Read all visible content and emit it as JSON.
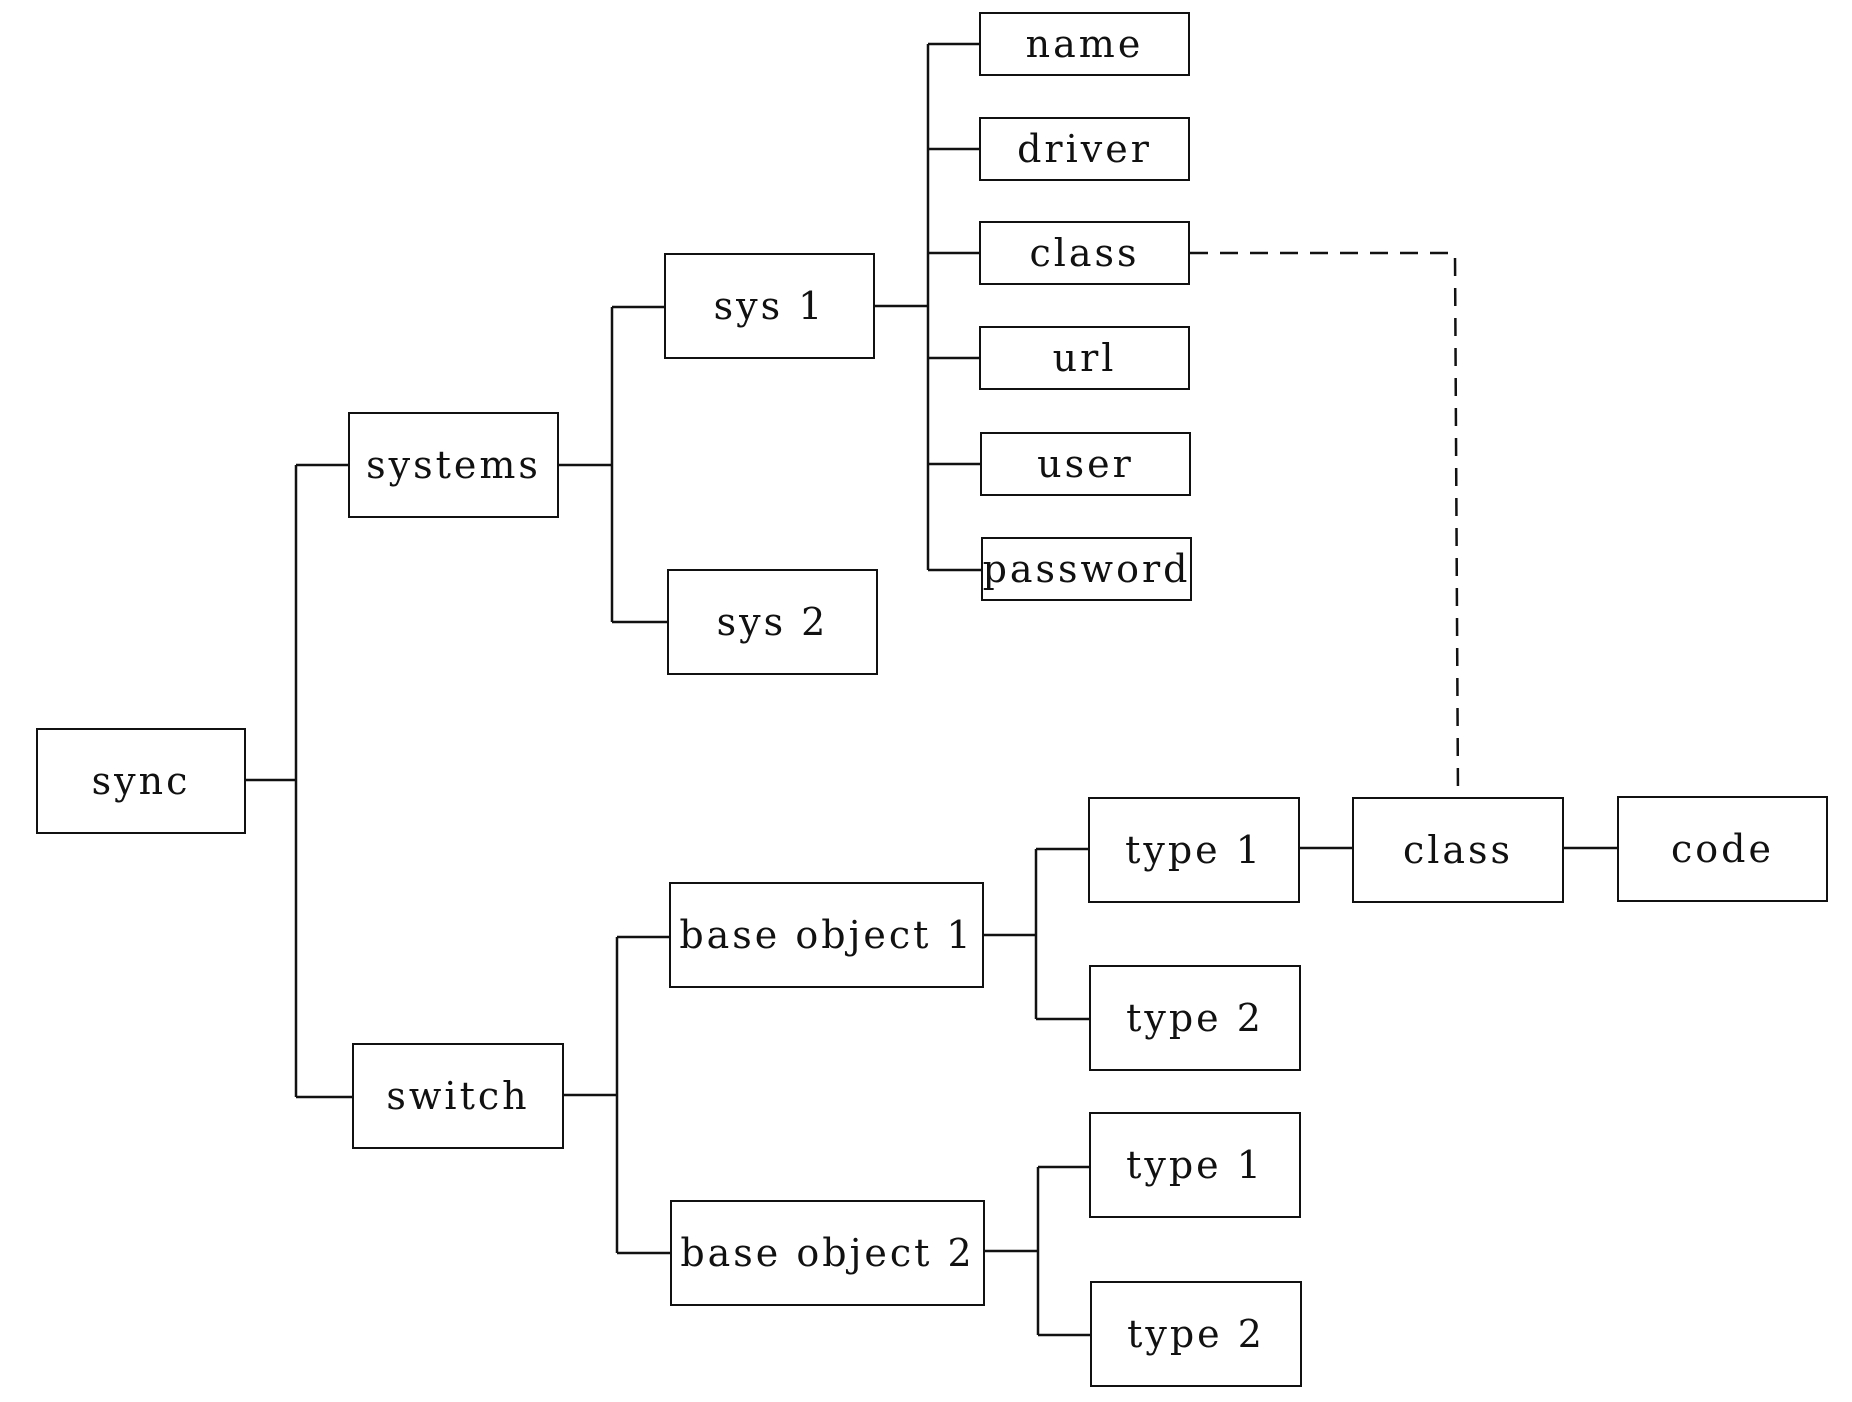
{
  "diagram": {
    "nodes": {
      "sync": "sync",
      "systems": "systems",
      "sys1": "sys 1",
      "sys2": "sys 2",
      "name": "name",
      "driver": "driver",
      "class_attr": "class",
      "url": "url",
      "user": "user",
      "password": "password",
      "switch": "switch",
      "base1": "base object 1",
      "base2": "base object 2",
      "b1type1": "type 1",
      "b1type2": "type 2",
      "b2type1": "type 1",
      "b2type2": "type 2",
      "class_node": "class",
      "code": "code"
    },
    "edges": [
      [
        "sync",
        "systems"
      ],
      [
        "sync",
        "switch"
      ],
      [
        "systems",
        "sys 1"
      ],
      [
        "systems",
        "sys 2"
      ],
      [
        "sys 1",
        "name"
      ],
      [
        "sys 1",
        "driver"
      ],
      [
        "sys 1",
        "class"
      ],
      [
        "sys 1",
        "url"
      ],
      [
        "sys 1",
        "user"
      ],
      [
        "sys 1",
        "password"
      ],
      [
        "switch",
        "base object 1"
      ],
      [
        "switch",
        "base object 2"
      ],
      [
        "base object 1",
        "type 1"
      ],
      [
        "base object 1",
        "type 2"
      ],
      [
        "base object 2",
        "type 1"
      ],
      [
        "base object 2",
        "type 2"
      ],
      [
        "type 1",
        "class"
      ],
      [
        "class",
        "code"
      ]
    ],
    "dashed_link": [
      "class (sys 1 attribute)",
      "class (type 1)"
    ]
  }
}
